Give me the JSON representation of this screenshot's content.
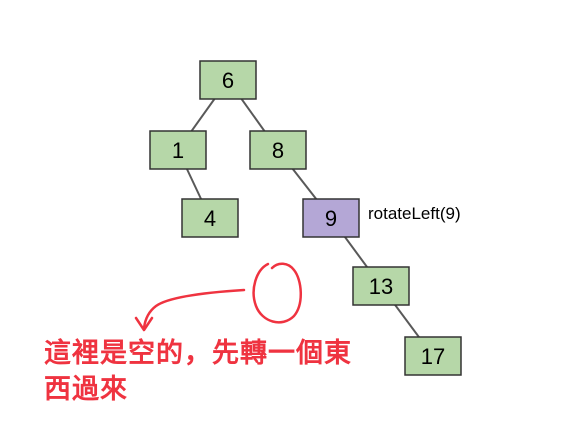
{
  "tree": {
    "nodes": [
      {
        "id": "n6",
        "label": "6",
        "role": "normal"
      },
      {
        "id": "n1",
        "label": "1",
        "role": "normal"
      },
      {
        "id": "n8",
        "label": "8",
        "role": "normal"
      },
      {
        "id": "n4",
        "label": "4",
        "role": "normal"
      },
      {
        "id": "n9",
        "label": "9",
        "role": "pivot"
      },
      {
        "id": "n13",
        "label": "13",
        "role": "normal"
      },
      {
        "id": "n17",
        "label": "17",
        "role": "normal"
      }
    ],
    "edges": [
      [
        "n6",
        "n1"
      ],
      [
        "n6",
        "n8"
      ],
      [
        "n1",
        "n4"
      ],
      [
        "n8",
        "n9"
      ],
      [
        "n9",
        "n13"
      ],
      [
        "n13",
        "n17"
      ]
    ]
  },
  "annotation": {
    "operation": "rotateLeft(9)"
  },
  "note": {
    "line1": "這裡是空的，先轉一個東",
    "line2": "西過來"
  },
  "colors": {
    "node_fill": "#b6d7a8",
    "pivot_fill": "#b4a7d6",
    "edge": "#595959",
    "note": "#ef3340"
  }
}
